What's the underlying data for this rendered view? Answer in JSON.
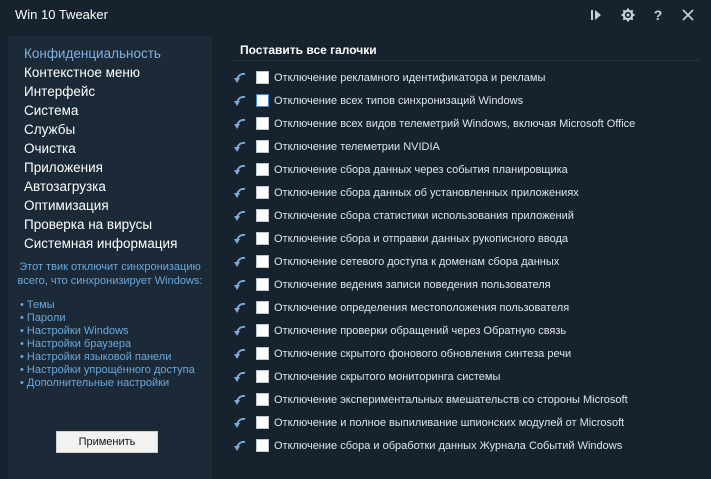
{
  "app": {
    "title": "Win 10 Tweaker"
  },
  "titlebar": {
    "buttons": [
      "play-icon",
      "gear-icon",
      "help-icon",
      "close-icon"
    ],
    "help_label": "?"
  },
  "sidebar": {
    "items": [
      {
        "label": "Конфиденциальность",
        "active": true
      },
      {
        "label": "Контекстное меню"
      },
      {
        "label": "Интерфейс"
      },
      {
        "label": "Система"
      },
      {
        "label": "Службы"
      },
      {
        "label": "Очистка"
      },
      {
        "label": "Приложения"
      },
      {
        "label": "Автозагрузка"
      },
      {
        "label": "Оптимизация"
      },
      {
        "label": "Проверка на вирусы"
      },
      {
        "label": "Системная информация"
      }
    ],
    "hint_line1": "Этот твик отключит синхронизацию",
    "hint_line2": "всего, что синхронизирует Windows:",
    "sync_items": [
      "• Темы",
      "• Пароли",
      "• Настройки Windows",
      "• Настройки браузера",
      "• Настройки языковой панели",
      "• Настройки упрощённого доступа",
      "• Дополнительные настройки"
    ],
    "apply_label": "Применить"
  },
  "main": {
    "header": "Поставить все галочки",
    "options": [
      "Отключение рекламного идентификатора и рекламы",
      "Отключение всех типов синхронизаций Windows",
      "Отключение всех видов телеметрий Windows, включая Microsoft Office",
      "Отключение телеметрии NVIDIA",
      "Отключение сбора данных через события планировщика",
      "Отключение сбора данных об установленных приложениях",
      "Отключение сбора статистики использования приложений",
      "Отключение сбора и отправки данных рукописного ввода",
      "Отключение сетевого доступа к доменам сбора данных",
      "Отключение ведения записи поведения пользователя",
      "Отключение определения местоположения пользователя",
      "Отключение проверки обращений через Обратную связь",
      "Отключение скрытого фонового обновления синтеза речи",
      "Отключение скрытого мониторинга системы",
      "Отключение экспериментальных вмешательств со стороны Microsoft",
      "Отключение и полное выпиливание шпионских модулей от Microsoft",
      "Отключение сбора и обработки данных Журнала Событий Windows"
    ]
  },
  "colors": {
    "background": "#16222e",
    "sidebar": "#1c2a38",
    "accent": "#6aa8dd",
    "active_nav": "#7fb1de"
  }
}
